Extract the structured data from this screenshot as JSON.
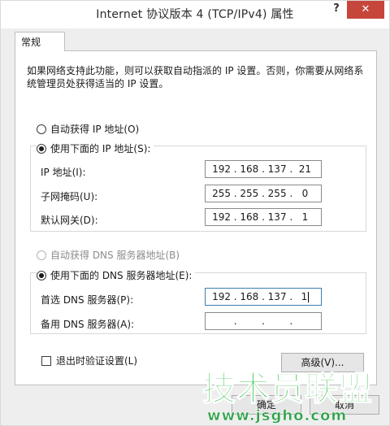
{
  "window": {
    "title": "Internet 协议版本 4 (TCP/IPv4) 属性",
    "help_glyph": "?",
    "close_glyph": "✕"
  },
  "tab": {
    "label": "常规"
  },
  "description": "如果网络支持此功能，则可以获取自动指派的 IP 设置。否则，你需要从网络系统管理员处获得适当的 IP 设置。",
  "ip_section": {
    "auto_label": "自动获得 IP 地址(O)",
    "manual_label": "使用下面的 IP 地址(S):",
    "selected": "manual",
    "fields": [
      {
        "label": "IP 地址(I):",
        "octets": [
          "192",
          "168",
          "137",
          "21"
        ]
      },
      {
        "label": "子网掩码(U):",
        "octets": [
          "255",
          "255",
          "255",
          "0"
        ]
      },
      {
        "label": "默认网关(D):",
        "octets": [
          "192",
          "168",
          "137",
          "1"
        ]
      }
    ]
  },
  "dns_section": {
    "auto_label": "自动获得 DNS 服务器地址(B)",
    "manual_label": "使用下面的 DNS 服务器地址(E):",
    "selected": "manual",
    "fields": [
      {
        "label": "首选 DNS 服务器(P):",
        "octets": [
          "192",
          "168",
          "137",
          "1"
        ]
      },
      {
        "label": "备用 DNS 服务器(A):",
        "octets": [
          "",
          "",
          "",
          ""
        ]
      }
    ]
  },
  "validate_label": "退出时验证设置(L)",
  "advanced_label": "高级(V)...",
  "ok_label": "确定",
  "cancel_label": "取消",
  "watermark": {
    "text": "技术员联盟",
    "url": "www.jsgho.com"
  }
}
